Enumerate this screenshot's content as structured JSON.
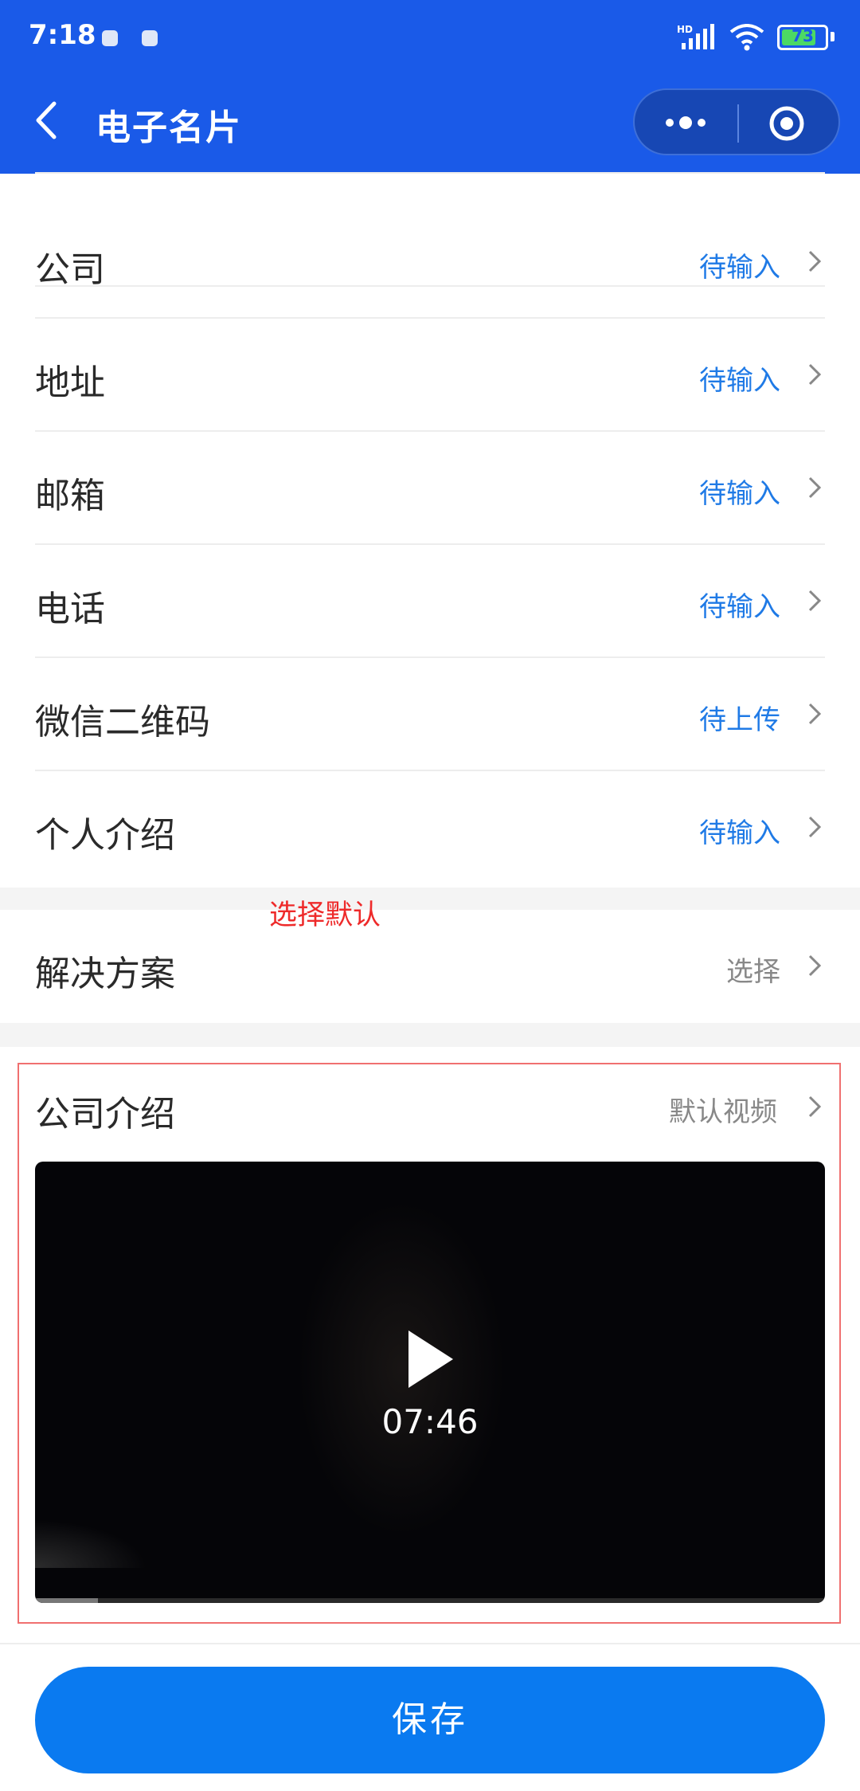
{
  "status_bar": {
    "time": "7:18",
    "network": "HD",
    "battery": "73",
    "battery_level": 0.73,
    "icons": [
      "app-notification-icon",
      "app-notification-icon",
      "signal-icon",
      "wifi-icon",
      "battery-icon"
    ]
  },
  "nav": {
    "title": "电子名片",
    "back_icon": "back-chevron-icon",
    "more_icon": "more-dots-icon",
    "close_icon": "target-circle-icon"
  },
  "rows": [
    {
      "label": "公司",
      "value": "待输入"
    },
    {
      "label": "地址",
      "value": "待输入"
    },
    {
      "label": "邮箱",
      "value": "待输入"
    },
    {
      "label": "电话",
      "value": "待输入"
    },
    {
      "label": "微信二维码",
      "value": "待上传"
    },
    {
      "label": "个人介绍",
      "value": "待输入"
    }
  ],
  "annotation": "选择默认",
  "solution_row": {
    "label": "解决方案",
    "value": "选择"
  },
  "company_intro": {
    "label": "公司介绍",
    "value": "默认视频",
    "video": {
      "duration": "07:46",
      "progress": 0.08
    }
  },
  "save_button": "保存",
  "colors": {
    "nav_bg": "#1a5ae8",
    "accent_blue": "#1f7ae6",
    "button_blue": "#0a7af0",
    "annotation_red": "#ee2a2a"
  }
}
